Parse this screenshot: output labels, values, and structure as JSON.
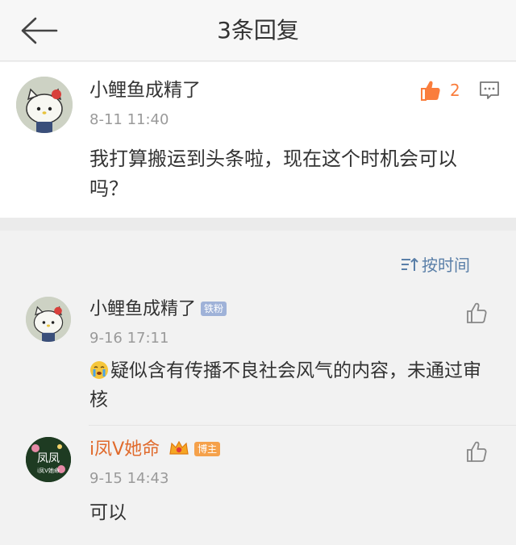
{
  "header": {
    "title": "3条回复"
  },
  "main_comment": {
    "author": "小鲤鱼成精了",
    "time": "8-11 11:40",
    "content": "我打算搬运到头条啦，现在这个时机会可以吗？",
    "likes": "2"
  },
  "sort": {
    "label": "按时间"
  },
  "replies": [
    {
      "author": "小鲤鱼成精了",
      "badge": "铁粉",
      "time": "9-16 17:11",
      "content": "疑似含有传播不良社会风气的内容，未通过审核"
    },
    {
      "author": "i凤V她命",
      "badge": "博主",
      "time": "9-15 14:43",
      "content": "可以",
      "avatar_text": "凤凤",
      "avatar_subtext": "i凤V她命"
    }
  ],
  "colors": {
    "accent_orange": "#fa7d3c",
    "link_blue": "#5a7fa8"
  }
}
